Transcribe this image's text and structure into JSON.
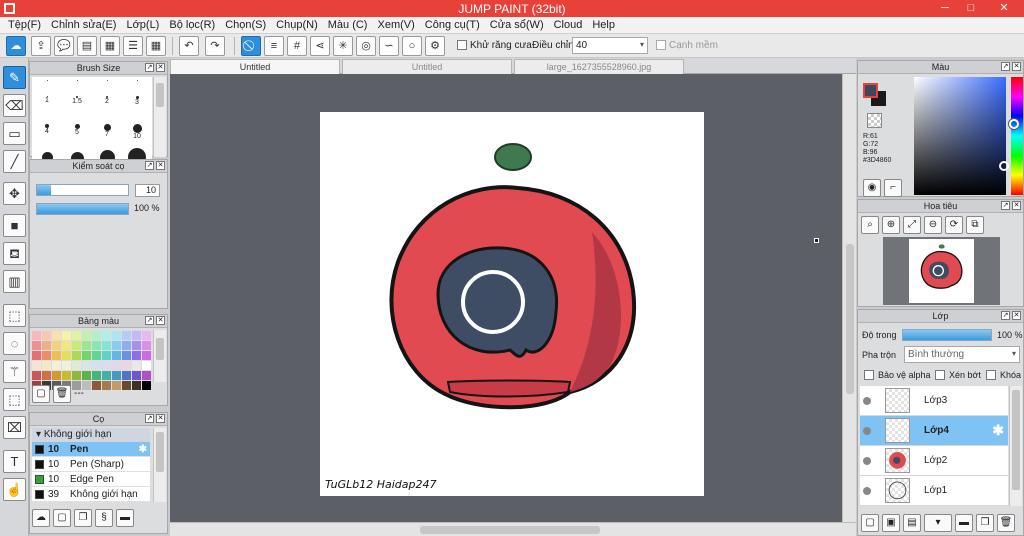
{
  "window": {
    "title": "JUMP PAINT (32bit)",
    "minimize": "─",
    "maximize": "□",
    "close": "✕"
  },
  "menu": [
    "Tệp(F)",
    "Chỉnh sửa(E)",
    "Lớp(L)",
    "Bộ lọc(R)",
    "Chọn(S)",
    "Chụp(N)",
    "Màu (C)",
    "Xem(V)",
    "Công cụ(T)",
    "Cửa sổ(W)",
    "Cloud",
    "Help"
  ],
  "toolbar": {
    "antialias_label": "Khử răng cưa",
    "adjust_label": "Điều chỉnh",
    "adjust_value": "40",
    "edge_label": "Cạnh mềm"
  },
  "tabs": [
    "Untitled",
    "Untitled",
    "large_1627355528960.jpg"
  ],
  "brush_size": {
    "title": "Brush Size",
    "labels": [
      "1",
      "1.5",
      "2",
      "3",
      "4",
      "5",
      "7",
      "10"
    ]
  },
  "size_control": {
    "title": "Kiểm soát cọ",
    "size_value": "10",
    "opacity_value": "100 %",
    "size_fraction": 0.15,
    "opacity_fraction": 1.0
  },
  "palette": {
    "title": "Bảng màu",
    "more": "---",
    "colors": [
      "#f7b8b8",
      "#f8c9b0",
      "#f9e2aa",
      "#f7f3a8",
      "#dff3a6",
      "#c2f0b0",
      "#b0f0cb",
      "#aef0e8",
      "#aee2f5",
      "#b3cdf6",
      "#c6b8f5",
      "#e8b8f3",
      "#f08f8f",
      "#f2ae89",
      "#f3d27f",
      "#eeea7c",
      "#c8ea7b",
      "#9ee68c",
      "#88e6b2",
      "#86e3d9",
      "#88cdee",
      "#8daeef",
      "#a88fef",
      "#db8fea",
      "#e86f6f",
      "#eb8d67",
      "#eebd5a",
      "#e4de58",
      "#abd958",
      "#77d469",
      "#62d596",
      "#60d2c6",
      "#62b7e5",
      "#6c90e6",
      "#8e6fe6",
      "#cb6de0",
      "#f6e3d3",
      "#f3e8c7",
      "#f5f0d5",
      "#eef0e0",
      "#e0eadb",
      "#d8e6e3",
      "#d4e1ee",
      "#dddcef",
      "#e6d6ea",
      "#ecd5df",
      "#e8e8e8",
      "#ffffff",
      "#ce5555",
      "#d17044",
      "#cf9a32",
      "#c5bd2f",
      "#8fb83c",
      "#5bb34d",
      "#47b47a",
      "#42b0a5",
      "#4599c6",
      "#4e73c7",
      "#7255c6",
      "#ad52c0",
      "#a33c3c",
      "#3a3a3a",
      "#5a5a5a",
      "#7b7b7b",
      "#9c9c9c",
      "#bdbdbd",
      "#8a5a3a",
      "#a57a50",
      "#c49a6c",
      "#6a4a30",
      "#403020",
      "#000000"
    ]
  },
  "brush_panel": {
    "title": "Cọ",
    "group": "Không giới hạn",
    "items": [
      {
        "size": "10",
        "name": "Pen",
        "color": "#111111"
      },
      {
        "size": "10",
        "name": "Pen (Sharp)",
        "color": "#111111"
      },
      {
        "size": "10",
        "name": "Edge Pen",
        "color": "#2ea52e"
      },
      {
        "size": "39",
        "name": "Không giới hạn",
        "color": "#111111"
      }
    ]
  },
  "canvas": {
    "signature": "TuGLb12 Haidap247"
  },
  "color_panel": {
    "title": "Màu",
    "r": "R:61",
    "g": "G:72",
    "b": "B:96",
    "hex": "#3D4860",
    "main_color": "#3d4860"
  },
  "navigator": {
    "title": "Hoa tiêu"
  },
  "layer_panel": {
    "title": "Lớp",
    "opacity_label": "Độ trong",
    "opacity_value": "100 %",
    "opacity_fraction": 1.0,
    "blend_label": "Pha trộn",
    "blend_value": "Bình thường",
    "protect_alpha": "Bảo vệ alpha",
    "clip": "Xén bớt",
    "lock": "Khóa",
    "layers": [
      {
        "name": "Lớp3",
        "selected": false
      },
      {
        "name": "Lớp4",
        "selected": true
      },
      {
        "name": "Lớp2",
        "selected": false
      },
      {
        "name": "Lớp1",
        "selected": false
      }
    ]
  }
}
